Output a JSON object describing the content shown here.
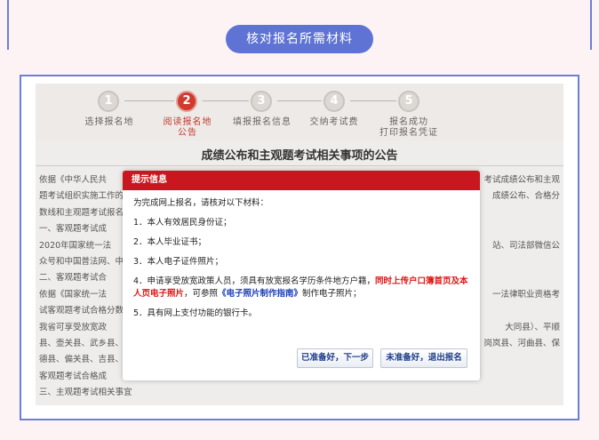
{
  "header": {
    "title": "核对报名所需材料"
  },
  "steps": [
    {
      "num": "1",
      "label": "选择报名地",
      "active": false
    },
    {
      "num": "2",
      "label": "阅读报名地\n公告",
      "active": true
    },
    {
      "num": "3",
      "label": "填报报名信息",
      "active": false
    },
    {
      "num": "4",
      "label": "交纳考试费",
      "active": false
    },
    {
      "num": "5",
      "label": "报名成功\n打印报名凭证",
      "active": false
    }
  ],
  "document": {
    "title": "成绩公布和主观题考试相关事项的公告",
    "lines": [
      {
        "left": "依据《中华人民共",
        "right": "考试成绩公布和主观"
      },
      {
        "left": "题考试组织实施工作的",
        "right": "成绩公布、合格分"
      },
      {
        "left": "数线和主观题考试报名",
        "right": ""
      },
      {
        "left": "一、客观题考试成",
        "right": ""
      },
      {
        "left": "2020年国家统一法",
        "right": "站、司法部微信公"
      },
      {
        "left": "众号和中国普法网、中",
        "right": ""
      },
      {
        "left": "二、客观题考试合",
        "right": ""
      },
      {
        "left": "依据《国家统一法",
        "right": "一法律职业资格考"
      },
      {
        "left": "试客观题考试合格分数",
        "right": ""
      },
      {
        "left": "我省可享受放宽政",
        "right": "大同县）、平顺"
      },
      {
        "left": "县、壶关县、武乡县、",
        "right": "岗岚县、河曲县、保"
      },
      {
        "left": "德县、偏关县、吉县、",
        "right": ""
      },
      {
        "left": "客观题考试合格成",
        "right": ""
      },
      {
        "left": "三、主观题考试相关事宜",
        "right": ""
      }
    ]
  },
  "dialog": {
    "title": "提示信息",
    "intro": "为完成网上报名，请核对以下材料：",
    "item1": "1．本人有效居民身份证；",
    "item2": "2．本人毕业证书；",
    "item3": "3．本人电子证件照片；",
    "item4_a": "4．申请享受放宽政策人员，须具有放宽报名学历条件地方户籍，",
    "item4_red": "同时上传户口簿首页及本人页电子照片",
    "item4_b": "，可参照",
    "item4_link": "《电子照片制作指南》",
    "item4_c": "制作电子照片；",
    "item5": "5．具有网上支付功能的银行卡。",
    "btn_ready": "已准备好，下一步",
    "btn_not_ready": "未准备好，退出报名"
  },
  "colors": {
    "accent": "#5e73d4",
    "dialog_header": "#c8171e",
    "frame": "#6c7fd8"
  }
}
